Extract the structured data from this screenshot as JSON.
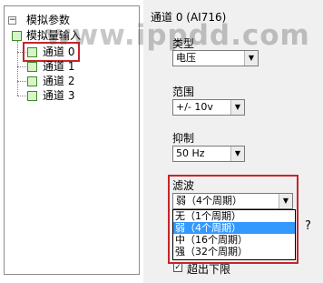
{
  "watermark": "www.ippdd.com",
  "tree": {
    "root_label": "模拟参数",
    "group_label": "模拟量输入",
    "channels": [
      "通道 0",
      "通道 1",
      "通道 2",
      "通道 3"
    ]
  },
  "panel": {
    "header": "通道 0 (AI716)",
    "type_label": "类型",
    "type_value": "电压",
    "range_label": "范围",
    "range_value": "+/- 10v",
    "suppress_label": "抑制",
    "suppress_value": "50 Hz",
    "filter_label": "滤波",
    "filter_value": "弱（4个周期）",
    "filter_options": [
      "无（1个周期）",
      "弱（4个周期）",
      "中（16个周期）",
      "强（32个周期）"
    ],
    "side_fragment": "?",
    "bottom_fragment": "超出下限"
  },
  "colors": {
    "highlight_border": "#c8242a",
    "selected_item": "#3399ff"
  }
}
